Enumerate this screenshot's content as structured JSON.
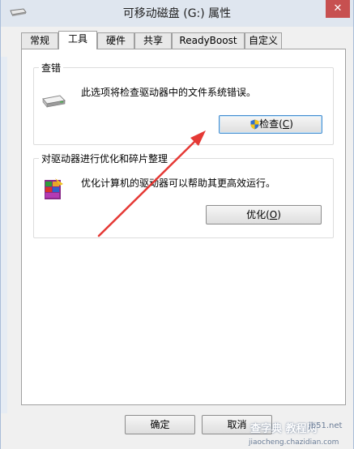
{
  "window": {
    "title": "可移动磁盘 (G:) 属性",
    "close_label": "✕"
  },
  "tabs": [
    {
      "label": "常规",
      "active": false
    },
    {
      "label": "工具",
      "active": true
    },
    {
      "label": "硬件",
      "active": false
    },
    {
      "label": "共享",
      "active": false
    },
    {
      "label": "ReadyBoost",
      "active": false
    },
    {
      "label": "自定义",
      "active": false
    }
  ],
  "check_group": {
    "title": "查错",
    "description": "此选项将检查驱动器中的文件系统错误。",
    "button_text": "检查(",
    "button_key": "C",
    "button_suffix": ")"
  },
  "optimize_group": {
    "title": "对驱动器进行优化和碎片整理",
    "description": "优化计算机的驱动器可以帮助其更高效运行。",
    "button_text": "优化(",
    "button_key": "O",
    "button_suffix": ")"
  },
  "footer": {
    "ok_label": "确定",
    "cancel_label": "取消"
  },
  "watermark": {
    "line1": "查字典  教程网",
    "line2": "jb51.net",
    "line3": "jiaocheng.chazidian.com"
  },
  "colors": {
    "annotation_arrow": "#e53935",
    "close_button": "#c75050",
    "focus_border": "#4a90d0"
  }
}
